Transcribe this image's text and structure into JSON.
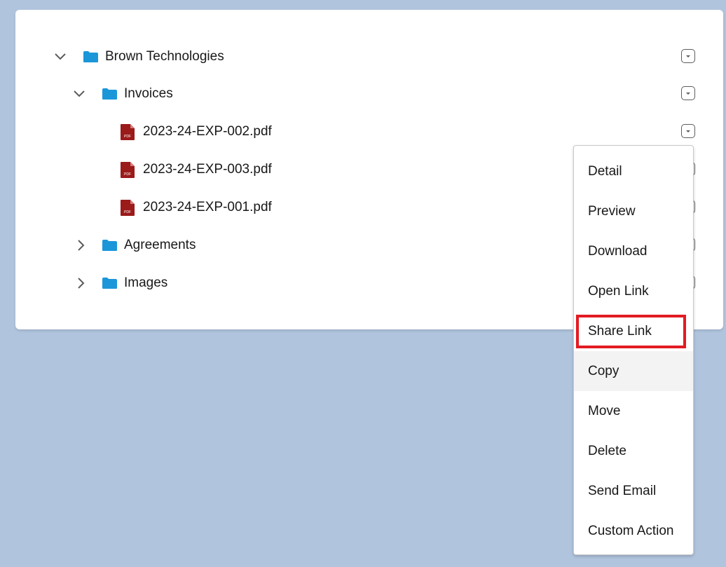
{
  "colors": {
    "background": "#b0c4de",
    "folder": "#1b96d9",
    "pdf": "#9b1a1a",
    "highlight": "#e21b23"
  },
  "tree": {
    "root": {
      "label": "Brown Technologies",
      "icon": "folder-icon",
      "expanded": true
    },
    "invoices": {
      "label": "Invoices",
      "icon": "folder-icon",
      "expanded": true
    },
    "files": [
      {
        "label": "2023-24-EXP-002.pdf",
        "icon": "pdf-file-icon"
      },
      {
        "label": "2023-24-EXP-003.pdf",
        "icon": "pdf-file-icon"
      },
      {
        "label": "2023-24-EXP-001.pdf",
        "icon": "pdf-file-icon"
      }
    ],
    "agreements": {
      "label": "Agreements",
      "icon": "folder-icon",
      "expanded": false
    },
    "images": {
      "label": "Images",
      "icon": "folder-icon",
      "expanded": false
    }
  },
  "menu": {
    "items": [
      {
        "label": "Detail"
      },
      {
        "label": "Preview"
      },
      {
        "label": "Download"
      },
      {
        "label": "Open Link"
      },
      {
        "label": "Share Link"
      },
      {
        "label": "Copy"
      },
      {
        "label": "Move"
      },
      {
        "label": "Delete"
      },
      {
        "label": "Send Email"
      },
      {
        "label": "Custom Action"
      }
    ]
  }
}
